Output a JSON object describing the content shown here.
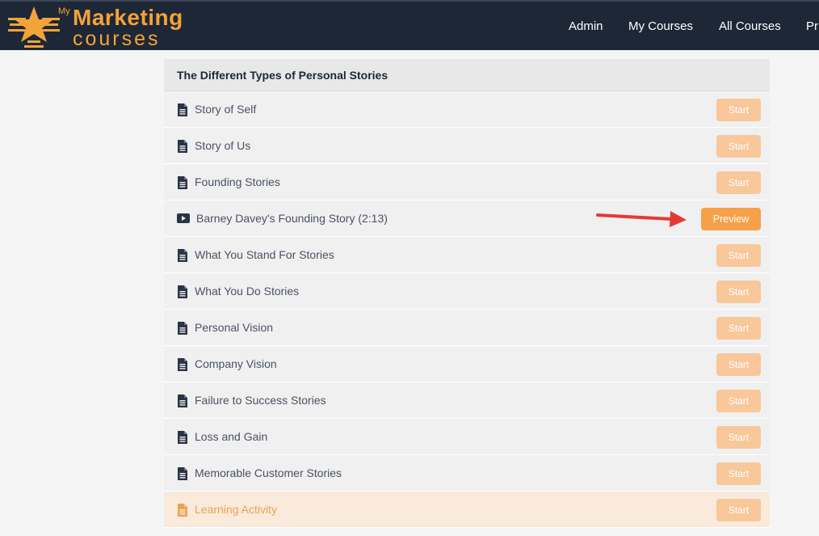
{
  "logo": {
    "my": "My",
    "marketing": "Marketing",
    "courses": "courses"
  },
  "nav": {
    "items": [
      "Admin",
      "My Courses",
      "All Courses",
      "Pr"
    ]
  },
  "section": {
    "title": "The Different Types of Personal Stories",
    "lessons": [
      {
        "title": "Story of Self",
        "type": "document",
        "button": "Start"
      },
      {
        "title": "Story of Us",
        "type": "document",
        "button": "Start"
      },
      {
        "title": "Founding Stories",
        "type": "document",
        "button": "Start"
      },
      {
        "title": "Barney Davey's Founding Story (2:13)",
        "type": "video",
        "button": "Preview"
      },
      {
        "title": "What You Stand For Stories",
        "type": "document",
        "button": "Start"
      },
      {
        "title": "What You Do Stories",
        "type": "document",
        "button": "Start"
      },
      {
        "title": "Personal Vision",
        "type": "document",
        "button": "Start"
      },
      {
        "title": "Company Vision",
        "type": "document",
        "button": "Start"
      },
      {
        "title": "Failure to Success Stories",
        "type": "document",
        "button": "Start"
      },
      {
        "title": "Loss and Gain",
        "type": "document",
        "button": "Start"
      },
      {
        "title": "Memorable Customer Stories",
        "type": "document",
        "button": "Start"
      },
      {
        "title": "Learning Activity",
        "type": "document",
        "button": "Start",
        "highlighted": true
      }
    ]
  },
  "colors": {
    "topbar": "#1e2736",
    "accent": "#f6a04a",
    "accent_light": "#f8c79a",
    "arrow": "#e53935"
  }
}
